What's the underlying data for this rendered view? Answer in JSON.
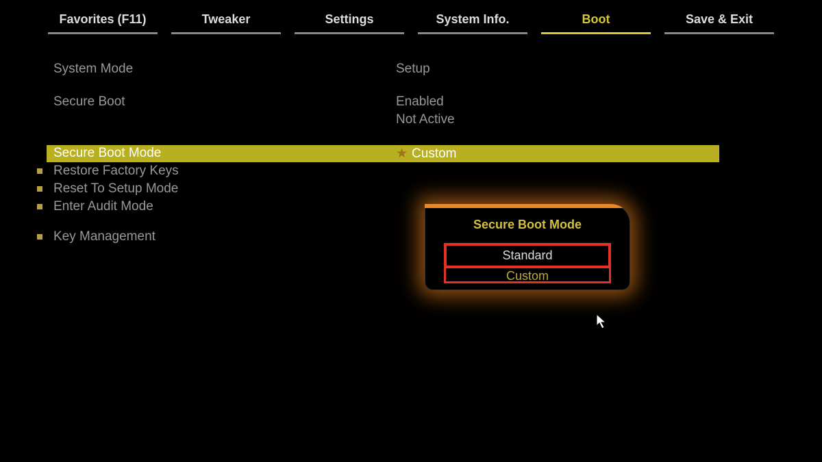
{
  "tabs": [
    {
      "label": "Favorites (F11)",
      "active": false
    },
    {
      "label": "Tweaker",
      "active": false
    },
    {
      "label": "Settings",
      "active": false
    },
    {
      "label": "System Info.",
      "active": false
    },
    {
      "label": "Boot",
      "active": true
    },
    {
      "label": "Save & Exit",
      "active": false
    }
  ],
  "settings": {
    "system_mode": {
      "label": "System Mode",
      "value": "Setup"
    },
    "secure_boot": {
      "label": "Secure Boot",
      "value": "Enabled",
      "value2": "Not Active"
    },
    "secure_boot_mode": {
      "label": "Secure Boot Mode",
      "value": "Custom"
    },
    "restore_factory": "Restore Factory Keys",
    "reset_setup": "Reset To Setup Mode",
    "enter_audit": "Enter Audit Mode",
    "key_management": "Key Management"
  },
  "popup": {
    "title": "Secure Boot Mode",
    "option1": "Standard",
    "option2": "Custom"
  }
}
